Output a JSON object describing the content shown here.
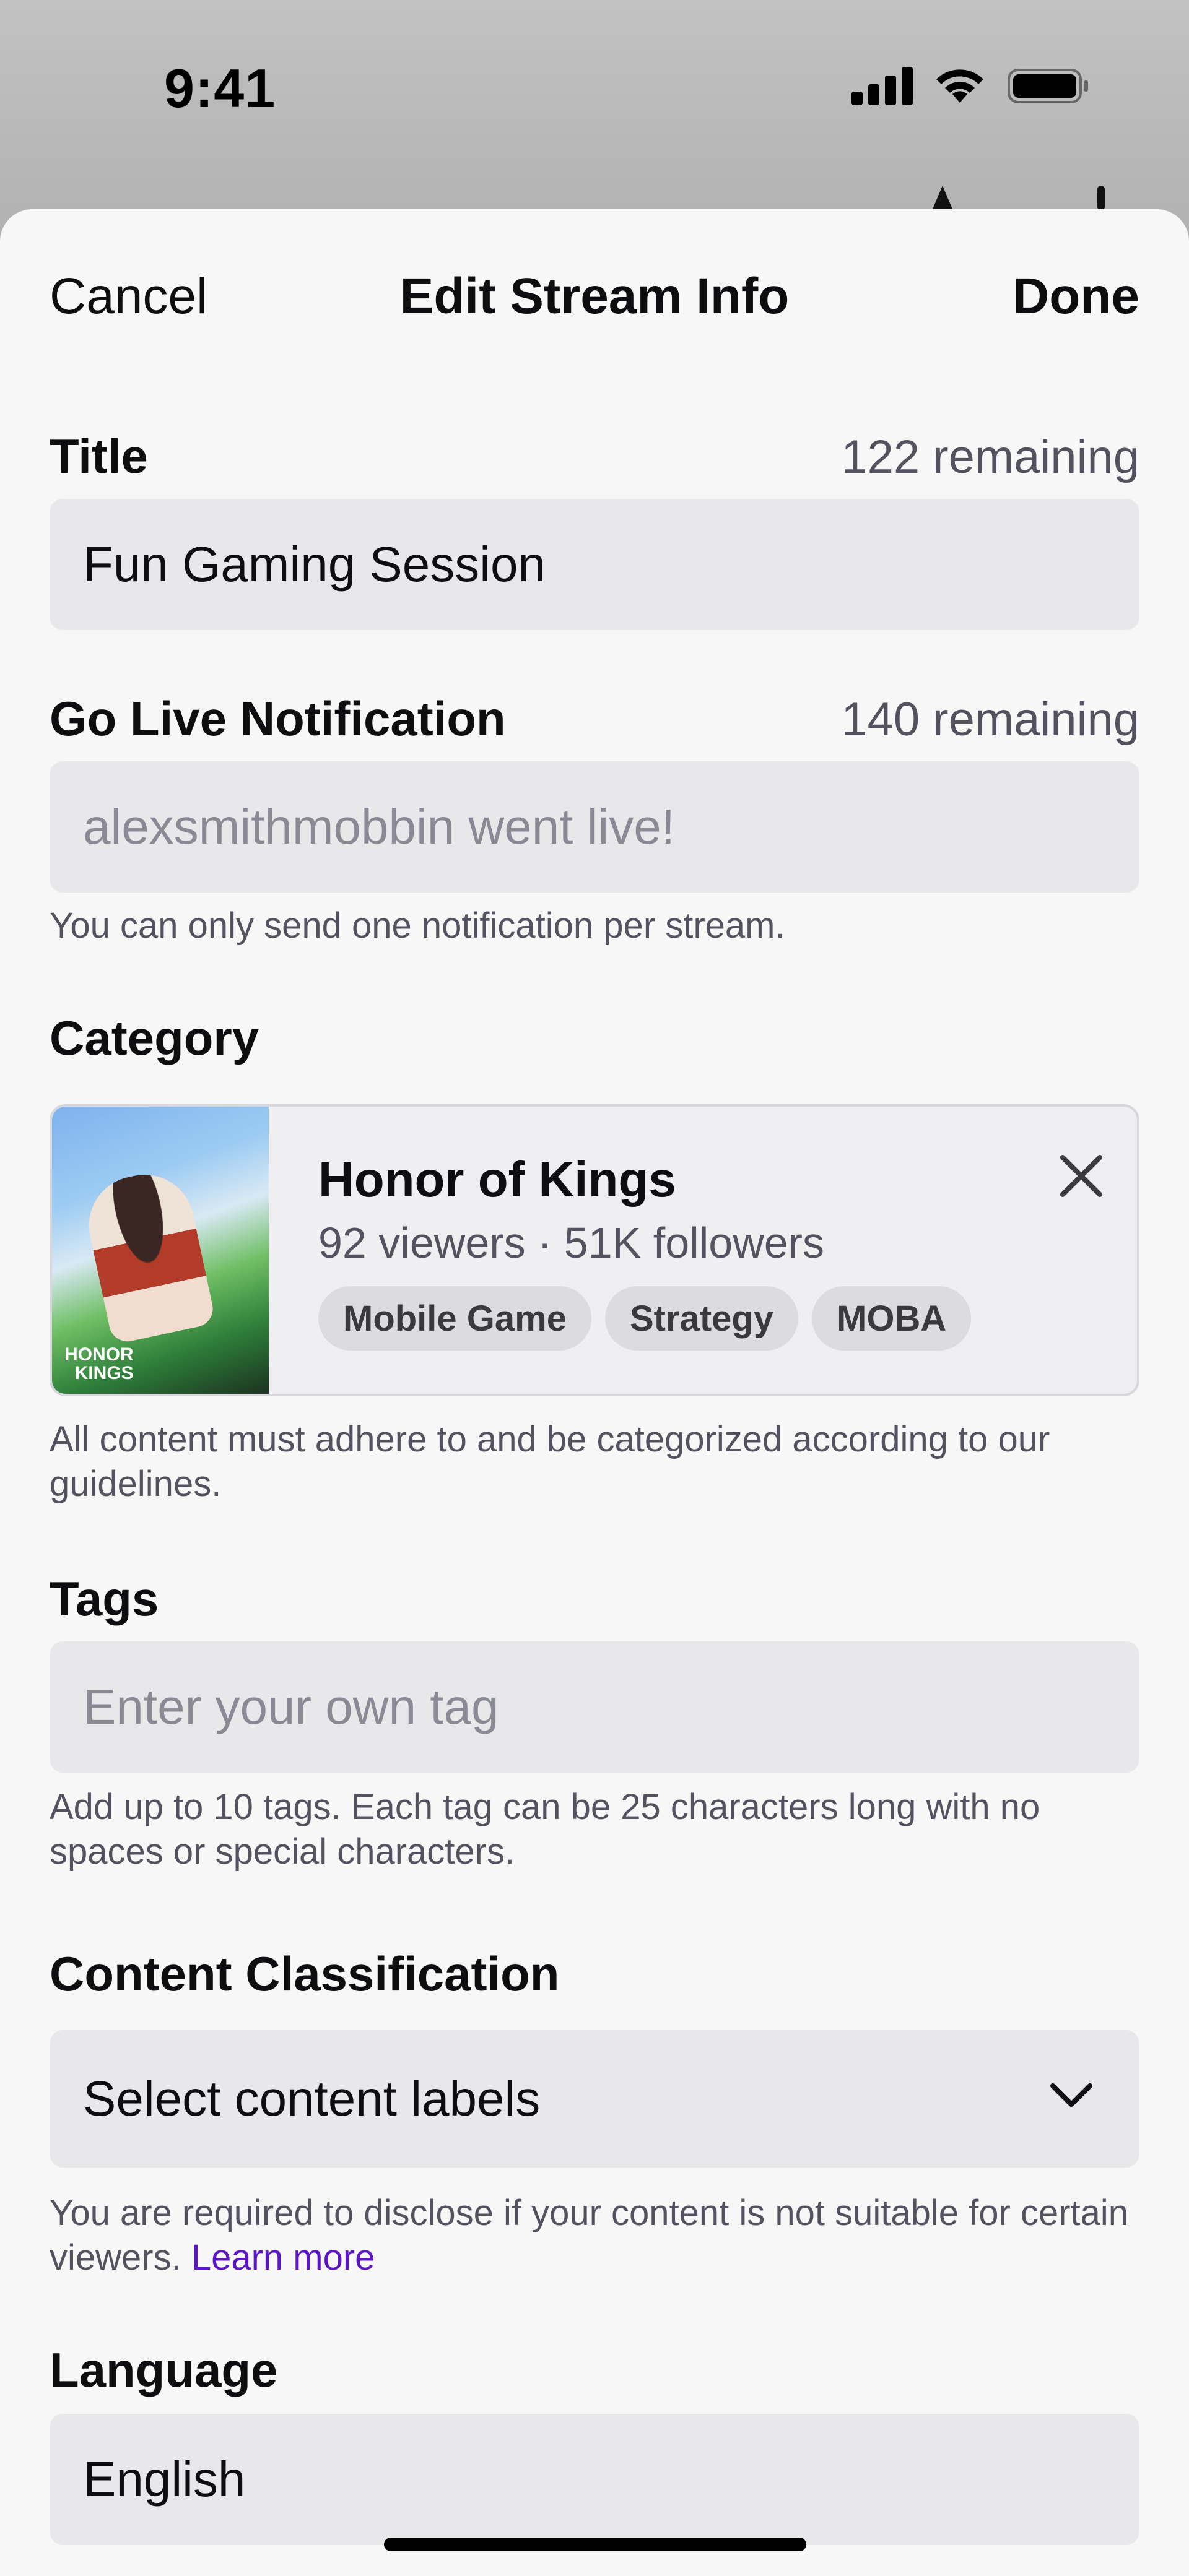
{
  "status_bar": {
    "time": "9:41"
  },
  "nav": {
    "cancel": "Cancel",
    "title": "Edit Stream Info",
    "done": "Done"
  },
  "title_field": {
    "label": "Title",
    "counter": "122 remaining",
    "value": "Fun Gaming Session"
  },
  "notification_field": {
    "label": "Go Live Notification",
    "counter": "140 remaining",
    "placeholder": "alexsmithmobbin went live!",
    "helper": "You can only send one notification per stream."
  },
  "category": {
    "label": "Category",
    "name": "Honor of Kings",
    "stats": "92 viewers · 51K followers",
    "tags": [
      "Mobile Game",
      "Strategy",
      "MOBA"
    ],
    "helper": "All content must adhere to and be categorized according to our guidelines."
  },
  "tags_field": {
    "label": "Tags",
    "placeholder": "Enter your own tag",
    "helper": "Add up to 10 tags. Each tag can be 25 characters long with no spaces or special characters."
  },
  "content_classification": {
    "label": "Content Classification",
    "value": "Select content labels",
    "helper": "You are required to disclose if your content is not suitable for certain viewers.",
    "link": "Learn more"
  },
  "language_field": {
    "label": "Language",
    "value": "English"
  },
  "icons": {
    "remove_category": "close-icon",
    "dropdown": "chevron-down-icon",
    "signal": "cellular-signal-icon",
    "wifi": "wifi-icon",
    "battery": "battery-icon"
  },
  "colors": {
    "link": "#5c16c5",
    "sheet_bg": "#f7f7f8",
    "input_bg": "#e8e8ea"
  }
}
